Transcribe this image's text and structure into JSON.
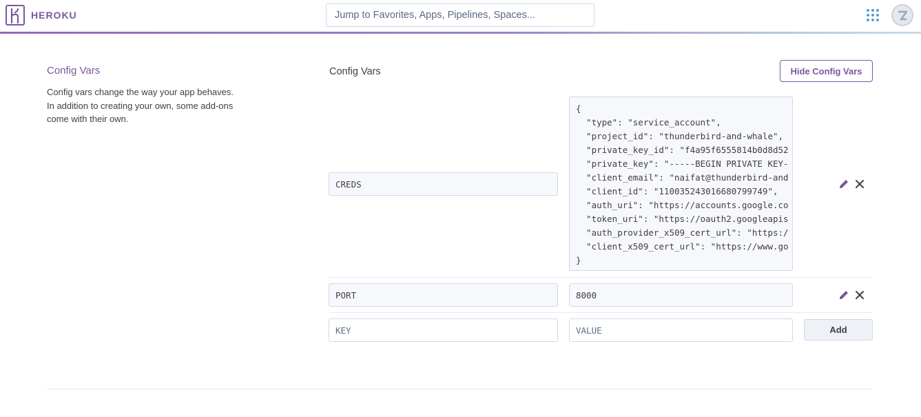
{
  "app": {
    "brand": "HEROKU",
    "search_placeholder": "Jump to Favorites, Apps, Pipelines, Spaces..."
  },
  "colors": {
    "brand_purple": "#79589f",
    "border": "#cfd7e6",
    "field_bg": "#f7f8fb"
  },
  "icons": {
    "logo": "heroku-logo-icon",
    "apps": "apps-grid-icon",
    "avatar": "user-avatar-icon",
    "edit": "pencil-icon",
    "delete": "close-icon"
  },
  "section": {
    "title": "Config Vars",
    "description": "Config vars change the way your app behaves. In addition to creating your own, some add-ons come with their own."
  },
  "panel": {
    "title": "Config Vars",
    "hide_button": "Hide Config Vars",
    "vars": [
      {
        "key": "CREDS",
        "value_lines": [
          "{",
          "  \"type\": \"service_account\",",
          "  \"project_id\": \"thunderbird-and-whale\",",
          "  \"private_key_id\": \"f4a95f6555814b0d8d52",
          "  \"private_key\": \"-----BEGIN PRIVATE KEY-",
          "  \"client_email\": \"naifat@thunderbird-and",
          "  \"client_id\": \"110035243016680799749\",",
          "  \"auth_uri\": \"https://accounts.google.co",
          "  \"token_uri\": \"https://oauth2.googleapis",
          "  \"auth_provider_x509_cert_url\": \"https:/",
          "  \"client_x509_cert_url\": \"https://www.go",
          "}"
        ]
      },
      {
        "key": "PORT",
        "value": "8000"
      }
    ],
    "new_var": {
      "key_placeholder": "KEY",
      "value_placeholder": "VALUE",
      "add_button": "Add"
    }
  }
}
